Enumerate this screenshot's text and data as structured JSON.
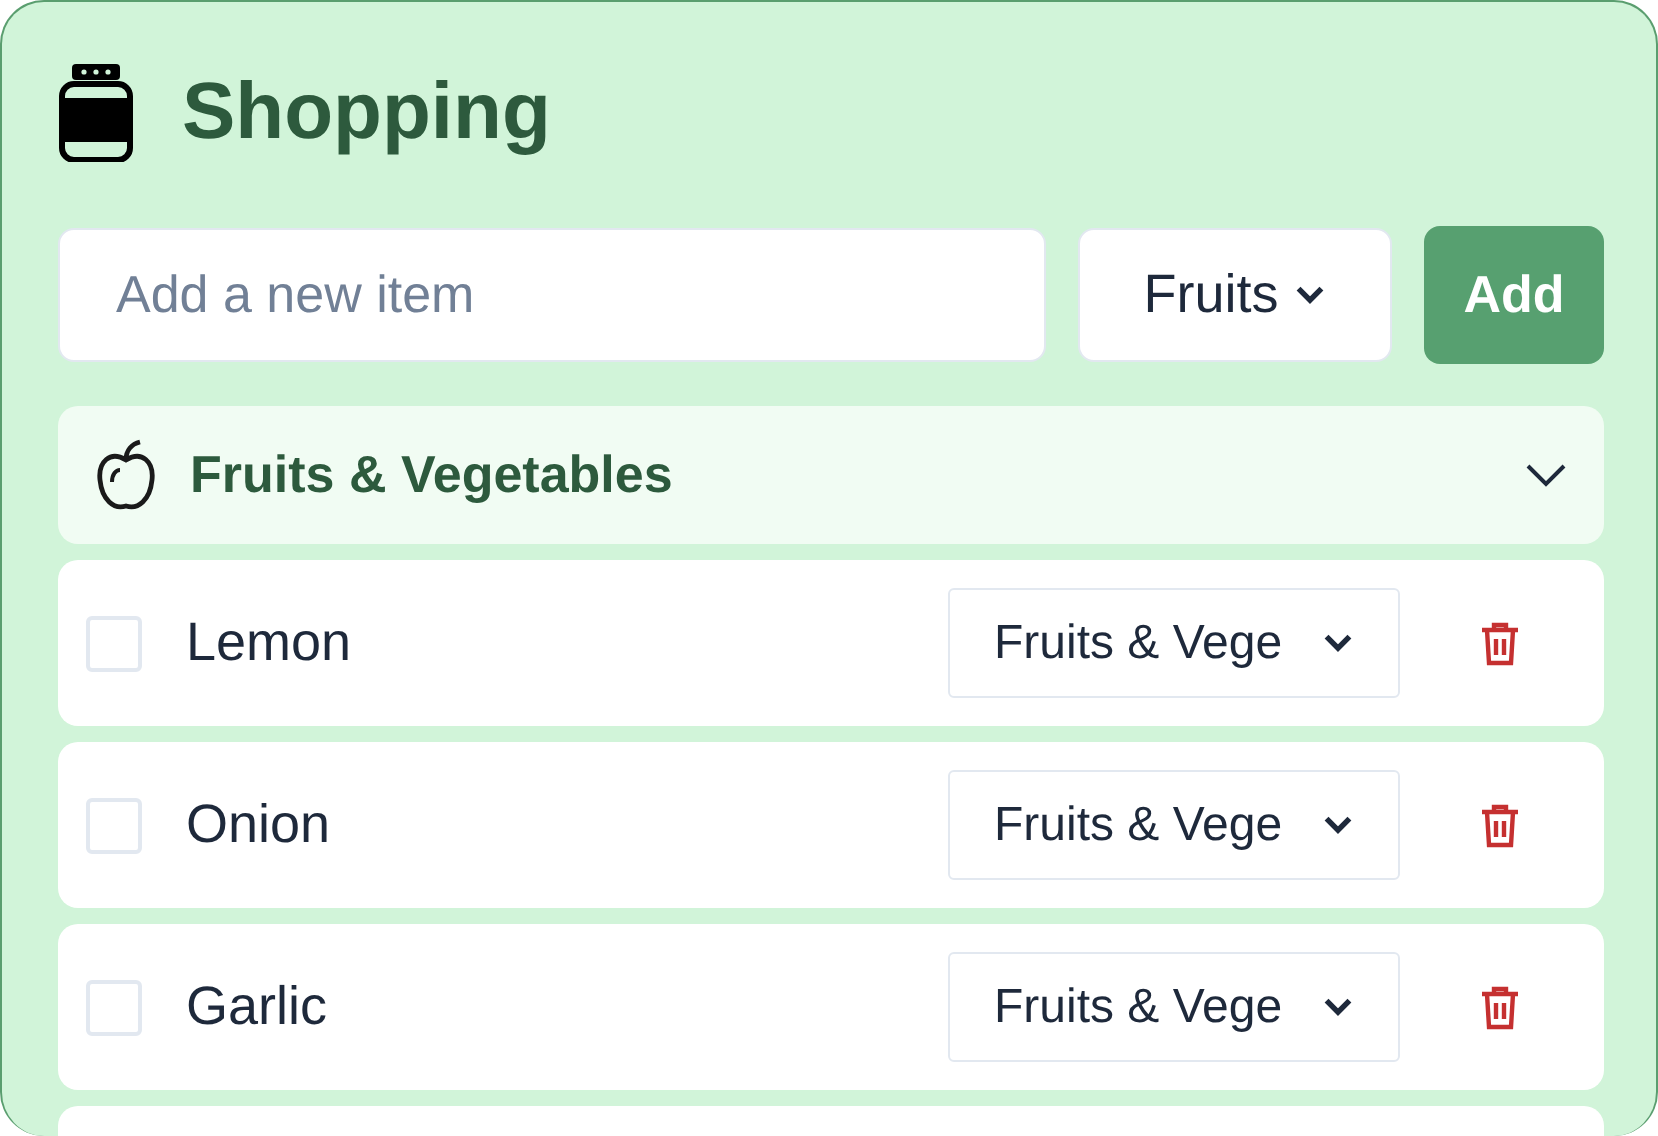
{
  "title": "Shopping",
  "new_item": {
    "placeholder": "Add a new item",
    "category": "Fruits",
    "add_button": "Add"
  },
  "group": {
    "name": "Fruits & Vegetables",
    "expanded": true
  },
  "items": [
    {
      "name": "Lemon",
      "checked": false,
      "category": "Fruits & Vege"
    },
    {
      "name": "Onion",
      "checked": false,
      "category": "Fruits & Vege"
    },
    {
      "name": "Garlic",
      "checked": false,
      "category": "Fruits & Vege"
    }
  ]
}
